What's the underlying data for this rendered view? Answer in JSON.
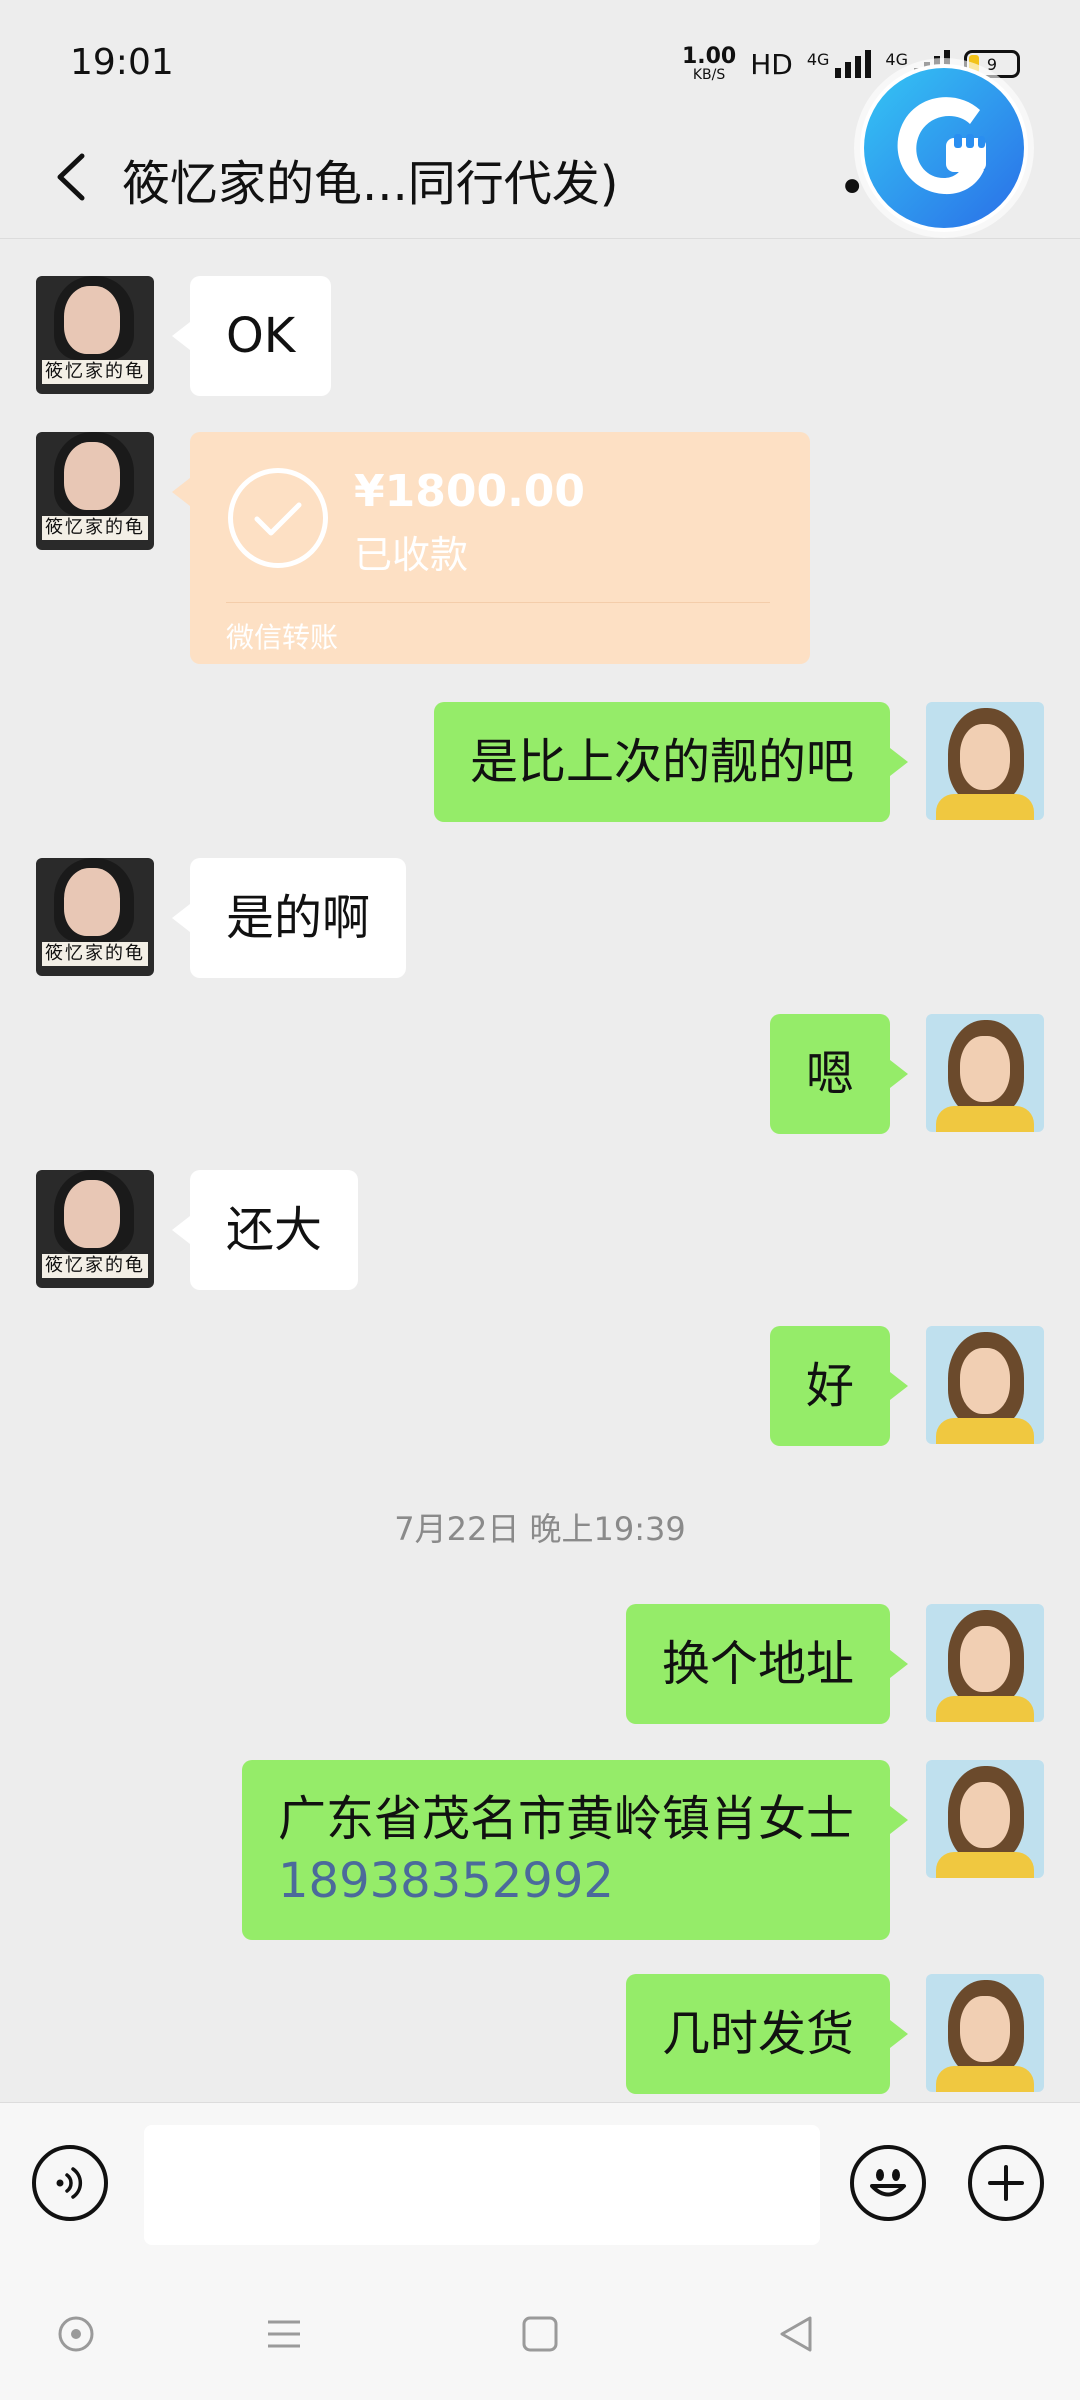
{
  "status_bar": {
    "time": "19:01",
    "net_speed": "1.00",
    "net_speed_unit": "KB/S",
    "hd_label": "HD",
    "signal1_label": "4G",
    "signal2_label": "4G",
    "battery_level": "9"
  },
  "nav": {
    "title": "筱忆家的龟...同行代发)",
    "back_icon": "chevron-left-icon",
    "more_icon": "more-dots-icon"
  },
  "avatar_caption": "筱忆家的龟",
  "messages": [
    {
      "side": "left",
      "type": "text",
      "text": "OK"
    },
    {
      "side": "left",
      "type": "transfer",
      "amount": "¥1800.00",
      "status": "已收款",
      "label": "微信转账"
    },
    {
      "side": "right",
      "type": "text",
      "text": "是比上次的靓的吧"
    },
    {
      "side": "left",
      "type": "text",
      "text": "是的啊"
    },
    {
      "side": "right",
      "type": "text",
      "text": "嗯"
    },
    {
      "side": "left",
      "type": "text",
      "text": "还大"
    },
    {
      "side": "right",
      "type": "text",
      "text": "好"
    },
    {
      "type": "timestamp",
      "text": "7月22日 晚上19:39"
    },
    {
      "side": "right",
      "type": "text",
      "text": "换个地址"
    },
    {
      "side": "right",
      "type": "text",
      "text": "广东省茂名市黄岭镇肖女士",
      "phone": "18938352992"
    },
    {
      "side": "right",
      "type": "text",
      "text": "几时发货"
    }
  ],
  "input_bar": {
    "voice_icon": "voice-icon",
    "emoji_icon": "emoji-icon",
    "plus_icon": "plus-icon",
    "value": ""
  },
  "colors": {
    "background": "#ededed",
    "bubble_mine": "#95ec69",
    "bubble_other": "#ffffff",
    "transfer_card": "#fde0c4",
    "phone_link": "#4b6a9b"
  }
}
